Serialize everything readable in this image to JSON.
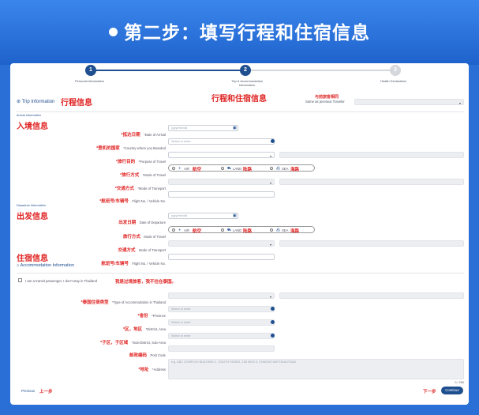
{
  "banner": {
    "title": "第二步：填写行程和住宿信息"
  },
  "steps": [
    {
      "num": "1",
      "label": "Personal Information"
    },
    {
      "num": "2",
      "label": "Trip & Accommodation Information"
    },
    {
      "num": "3",
      "label": "Health Declaration"
    }
  ],
  "annotations": {
    "trip_info_cn": "行程信息",
    "step2_cn": "行程和住宿信息",
    "same_as_prev_cn": "与前旅客相同",
    "arrival_cn": "入境信息",
    "departure_cn": "出发信息",
    "accommodation_cn": "住宿信息",
    "transit_cn": "我是过境旅客，我不住在泰国。",
    "prev_cn": "上一步",
    "next_cn": "下一步"
  },
  "trip_info": {
    "title": "Trip Information",
    "same_as_prev": "Same as previous Traveler"
  },
  "arrival": {
    "heading": "Arrival Information",
    "date_cn": "*抵达日期",
    "date_en": "*Date of Arrival",
    "date_ph": "yyyy/mm/dd",
    "country_cn": "*登机的国家",
    "country_en": "*Country where you Boarded",
    "country_ph": "Select or enter",
    "purpose_cn": "*旅行目的",
    "purpose_en": "*Purpose of Travel",
    "mode_cn": "*旅行方式",
    "mode_en": "*Mode of Travel",
    "transport_cn": "*交通方式",
    "transport_en": "*Mode of Transport",
    "flight_cn": "*航班号/车辆号",
    "flight_en": "Flight No. / Vehicle No."
  },
  "travel_modes": [
    {
      "en": "AIR",
      "cn": "航空"
    },
    {
      "en": "LAND",
      "cn": "陆路"
    },
    {
      "en": "SEA",
      "cn": "海路"
    }
  ],
  "departure": {
    "heading": "Departure Information",
    "date_cn": "出发日期",
    "date_en": "Date of Departure",
    "date_ph": "yyyy/mm/dd",
    "mode_cn": "旅行方式",
    "mode_en": "Mode of Travel",
    "transport_cn": "交通方式",
    "transport_en": "Mode of Transport",
    "flight_cn": "航班号/车辆号",
    "flight_en": "Flight No. / Vehicle No."
  },
  "accommodation": {
    "title": "Accommodation Information",
    "transit_en": "I am a transit passenger, I don't stay in Thailand",
    "type_cn": "*泰国住宿类型",
    "type_en": "*Type of Accommodation in Thailand",
    "province_cn": "*省份",
    "province_en": "*Province",
    "province_ph": "Select or enter",
    "district_cn": "*区，地区",
    "district_en": "*District, Area",
    "district_ph": "Select or enter",
    "subdistrict_cn": "*子区，子区域",
    "subdistrict_en": "*Sub-District, Sub-Area",
    "subdistrict_ph": "Select or enter",
    "postcode_cn": "邮政编码",
    "postcode_en": "Post Code",
    "address_cn": "*地址",
    "address_en": "*Address",
    "address_ph": "e.g. ABC COMPLEX BUILDING 4 , SOUTH SIDING, 138 MOO 3, CHAENG WATTANA ROAD",
    "counter": "0 / 250"
  },
  "footer": {
    "previous": "Previous",
    "continue": "Continue"
  },
  "colors": {
    "banner": "#2a6fd6",
    "accent": "#e02424",
    "stepActive": "#1f4f8f",
    "stepInactive": "#d4d7dc"
  }
}
